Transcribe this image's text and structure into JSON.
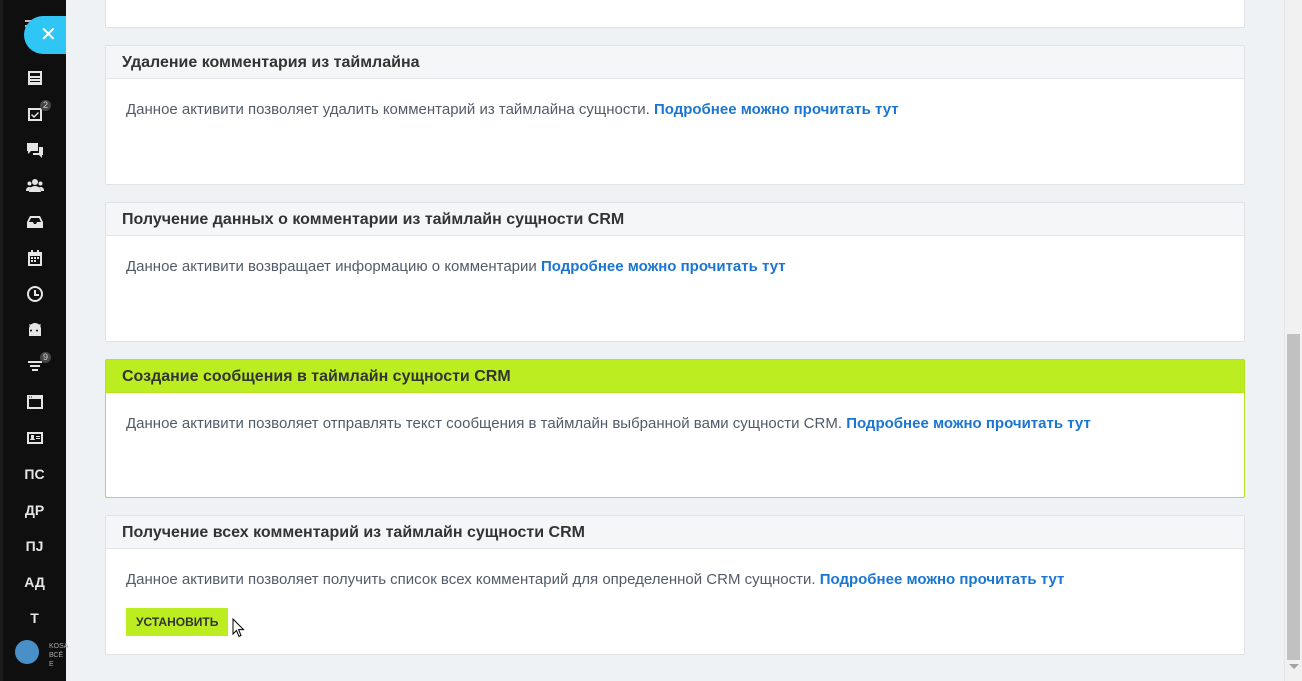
{
  "sidebar": {
    "close_glyph": "✕",
    "items": [
      {
        "icon": "newspaper-icon"
      },
      {
        "icon": "tasks-icon",
        "badge": "2"
      },
      {
        "icon": "chat-icon"
      },
      {
        "icon": "users-icon"
      },
      {
        "icon": "inbox-icon"
      },
      {
        "icon": "calendar-icon"
      },
      {
        "icon": "clock-icon"
      },
      {
        "icon": "robot-icon"
      },
      {
        "icon": "filter-icon",
        "badge": "9"
      },
      {
        "icon": "window-icon"
      },
      {
        "icon": "contact-card-icon"
      }
    ],
    "text_items": [
      "ПС",
      "ДР",
      "ПJ",
      "АД",
      "Т"
    ],
    "logo_text_line1": "KOSA",
    "logo_text_line2": "ВСЁ Е"
  },
  "cards": [
    {
      "title": "Удаление комментария из таймлайна",
      "description": "Данное активити позволяет удалить комментарий из таймлайна сущности.",
      "link": "Подробнее можно прочитать тут"
    },
    {
      "title": "Получение данных о комментарии из таймлайн сущности CRM",
      "description": "Данное активити возвращает информацию о комментарии",
      "link": "Подробнее можно прочитать тут"
    },
    {
      "title": "Создание сообщения в таймлайн сущности CRM",
      "description": "Данное активити позволяет отправлять текст сообщения в таймлайн выбранной вами сущности CRM.",
      "link": "Подробнее можно прочитать тут"
    },
    {
      "title": "Получение всех комментарий из таймлайн сущности CRM",
      "description": "Данное активити позволяет получить список всех комментарий для определенной CRM сущности.",
      "link": "Подробнее можно прочитать тут",
      "button": "УСТАНОВИТЬ"
    }
  ],
  "colors": {
    "accent_green": "#bbed21",
    "link_blue": "#1a76d2",
    "close_blue": "#2fc6f6",
    "sidebar_bg": "#0f0f10"
  }
}
